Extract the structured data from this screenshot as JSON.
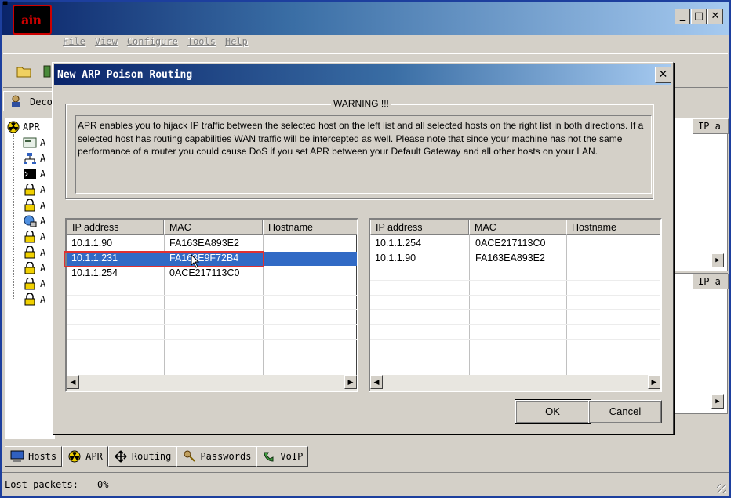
{
  "app": {
    "logo_text": "ain",
    "menu": [
      "File",
      "View",
      "Configure",
      "Tools",
      "Help"
    ],
    "window_buttons": {
      "minimize": "_",
      "maximize": "□",
      "close": "✕"
    },
    "top_tab_label": "Deco"
  },
  "tree": {
    "root_label": "APR",
    "child_prefix": "A"
  },
  "background_panes": {
    "column_header": "IP a"
  },
  "dialog": {
    "title": "New ARP Poison Routing",
    "close_label": "✕",
    "warning_legend": "WARNING !!!",
    "warning_text": "APR enables you to hijack IP traffic between the selected host on the left list and all selected hosts on the right list in both directions. If a selected host has routing capabilities WAN traffic will be intercepted as well. Please note that since your machine has not the same performance of a router you could cause DoS if you set APR between your Default Gateway and all other hosts on your LAN.",
    "columns": [
      "IP address",
      "MAC",
      "Hostname"
    ],
    "left_hosts": [
      {
        "ip": "10.1.1.90",
        "mac": "FA163EA893E2",
        "hostname": ""
      },
      {
        "ip": "10.1.1.231",
        "mac": "FA163E9F72B4",
        "hostname": ""
      },
      {
        "ip": "10.1.1.254",
        "mac": "0ACE217113C0",
        "hostname": ""
      }
    ],
    "left_selected_index": 1,
    "right_hosts": [
      {
        "ip": "10.1.1.254",
        "mac": "0ACE217113C0",
        "hostname": ""
      },
      {
        "ip": "10.1.1.90",
        "mac": "FA163EA893E2",
        "hostname": ""
      }
    ],
    "ok_label": "OK",
    "cancel_label": "Cancel"
  },
  "bottom_tabs": [
    {
      "label": "Hosts",
      "icon": "computer-icon"
    },
    {
      "label": "APR",
      "icon": "radiation-icon",
      "active": true
    },
    {
      "label": "Routing",
      "icon": "move-arrows-icon"
    },
    {
      "label": "Passwords",
      "icon": "key-person-icon"
    },
    {
      "label": "VoIP",
      "icon": "voip-icon"
    }
  ],
  "status": {
    "label": "Lost packets:",
    "value": "0%"
  },
  "colors": {
    "selection": "#316ac5",
    "highlight_box": "#e03030",
    "title_start": "#0a246a",
    "title_end": "#a6caf0"
  }
}
